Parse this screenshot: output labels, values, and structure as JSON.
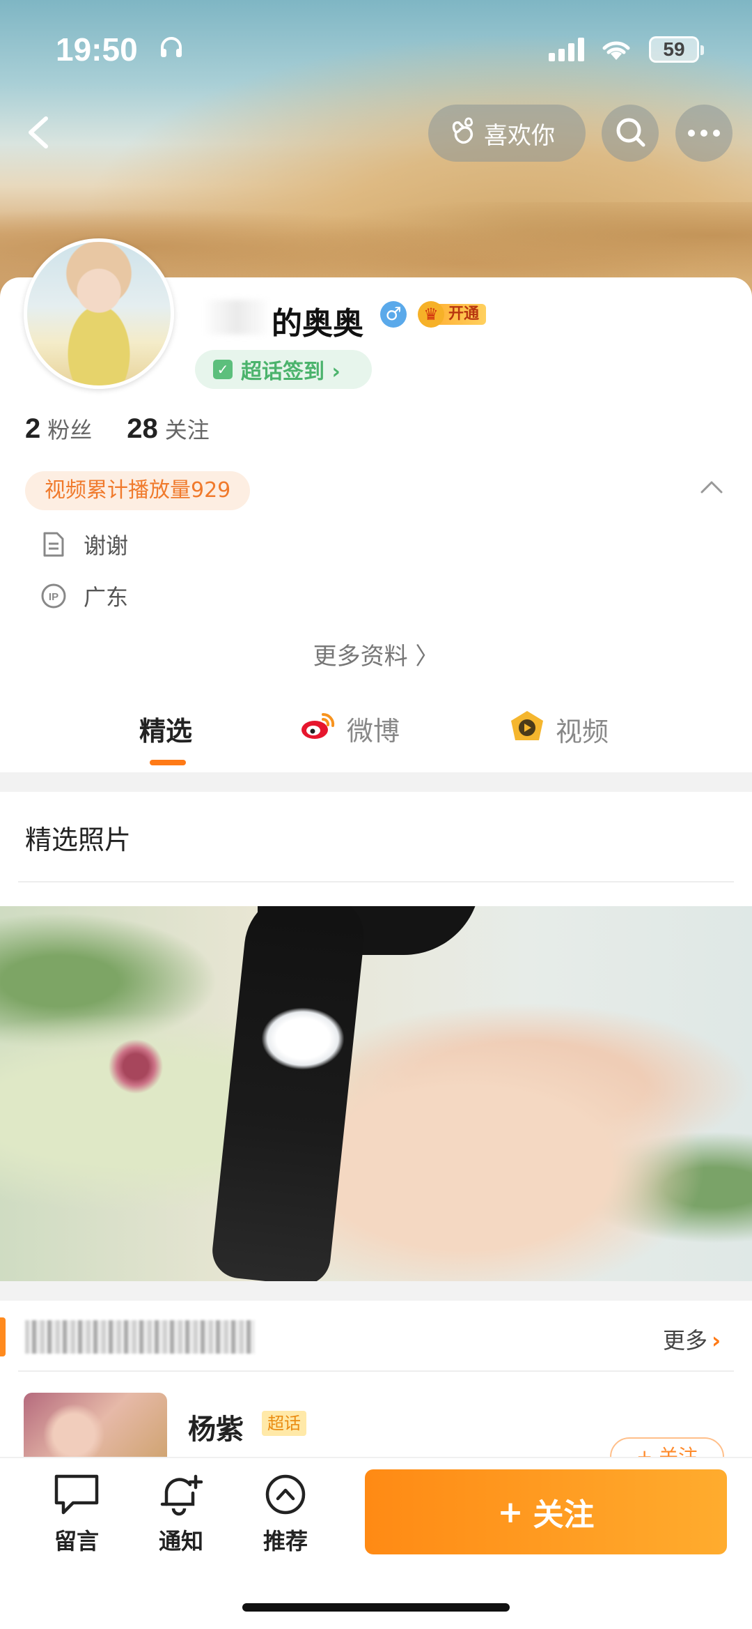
{
  "status_bar": {
    "time": "19:50",
    "battery": "59"
  },
  "header": {
    "like_label": "喜欢你"
  },
  "profile": {
    "username": "的奥奥",
    "gender_symbol": "♂",
    "vip_label": "开通",
    "checkin_label": "超话签到 ›",
    "followers_count": "2",
    "followers_label": "粉丝",
    "following_count": "28",
    "following_label": "关注",
    "video_views": "视频累计播放量929",
    "bio": "谢谢",
    "ip_location": "广东",
    "more_info": "更多资料 〉"
  },
  "tabs": [
    {
      "label": "精选"
    },
    {
      "label": "微博"
    },
    {
      "label": "视频"
    }
  ],
  "featured": {
    "photos_title": "精选照片"
  },
  "super_topics": {
    "more_label": "更多",
    "item_name": "杨紫",
    "item_tag": "超话",
    "follow_label": "+ 关注"
  },
  "bottom_bar": {
    "message_label": "留言",
    "notify_label": "通知",
    "recommend_label": "推荐",
    "follow_label": "关注",
    "follow_plus": "+"
  },
  "colors": {
    "accent": "#ff8a14",
    "green": "#4bb36c",
    "views_text": "#f07a2c"
  }
}
